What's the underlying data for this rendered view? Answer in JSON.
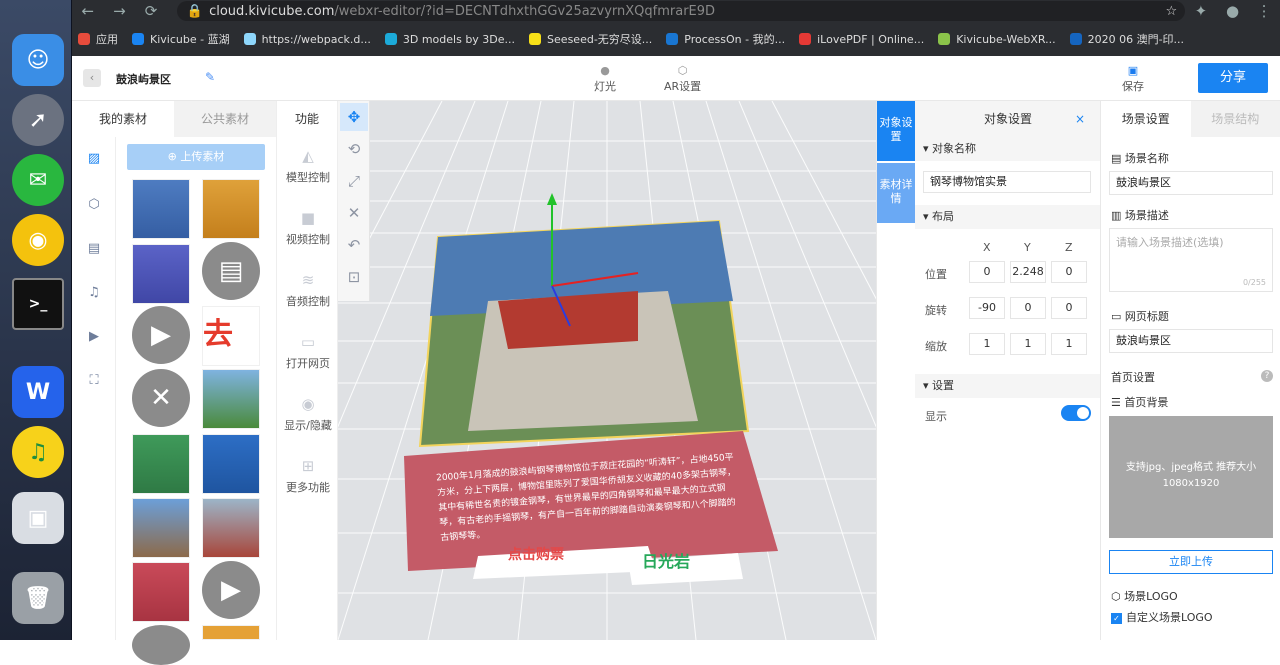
{
  "browser": {
    "url_host": "cloud.kivicube.com",
    "url_path": "/webxr-editor/?id=DECNTdhxthGGv25azvyrnXQqfmrarE9D",
    "bookmarks": [
      "应用",
      "Kivicube - 蓝湖",
      "https://webpack.d...",
      "3D models by 3De...",
      "Seeseed-无穷尽设...",
      "ProcessOn - 我的...",
      "iLovePDF | Online...",
      "Kivicube-WebXR...",
      "2020 06 澳門-印..."
    ]
  },
  "topbar": {
    "scene_title": "鼓浪屿景区",
    "light_label": "灯光",
    "ar_label": "AR设置",
    "save_label": "保存",
    "share_label": "分享"
  },
  "left": {
    "tab_mine": "我的素材",
    "tab_public": "公共素材",
    "upload_label": "上传素材"
  },
  "func": {
    "title": "功能",
    "items": [
      "模型控制",
      "视频控制",
      "音频控制",
      "打开网页",
      "显示/隐藏",
      "更多功能"
    ]
  },
  "canvas": {
    "caption": "2000年1月落成的鼓浪屿钢琴博物馆位于菽庄花园的“听涛轩”，占地450平方米，分上下两层，博物馆里陈列了爱国华侨胡友义收藏的40多架古钢琴，其中有稀世名贵的镀金钢琴，有世界最早的四角钢琴和最早最大的立式钢琴，有古老的手摇钢琴，有产自一百年前的脚踏自动演奏钢琴和八个脚踏的古钢琴等。",
    "sign1": "点击购票",
    "sign2": "日光岩"
  },
  "object": {
    "vtab1": "对象设置",
    "vtab2": "素材详情",
    "title": "对象设置",
    "close": "×",
    "name_section": "对象名称",
    "name_value": "钢琴博物馆实景",
    "layout_section": "布局",
    "axis": [
      "X",
      "Y",
      "Z"
    ],
    "position_label": "位置",
    "position": [
      "0",
      "2.248",
      "0"
    ],
    "rotation_label": "旋转",
    "rotation": [
      "-90",
      "0",
      "0"
    ],
    "scale_label": "缩放",
    "scale": [
      "1",
      "1",
      "1"
    ],
    "display_section": "设置",
    "display_label": "显示",
    "display_on": true
  },
  "scene": {
    "tab_settings": "场景设置",
    "tab_structure": "场景结构",
    "name_label": "场景名称",
    "name_value": "鼓浪屿景区",
    "desc_label": "场景描述",
    "desc_placeholder": "请输入场景描述(选填)",
    "desc_count": "0/255",
    "page_title_label": "网页标题",
    "page_title_value": "鼓浪屿景区",
    "home_label": "首页设置",
    "help": "?",
    "bg_label": "首页背景",
    "bg_hint": "支持jpg、jpeg格式 推荐大小1080x1920",
    "upload_label": "立即上传",
    "logo_label": "场景LOGO",
    "custom_logo_label": "自定义场景LOGO"
  },
  "colors": {
    "accent": "#1a84f2",
    "caption_card": "#c45b67"
  }
}
